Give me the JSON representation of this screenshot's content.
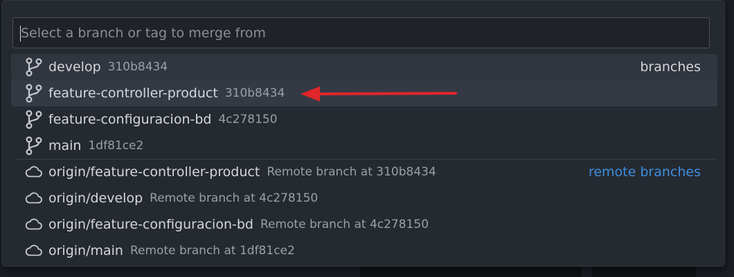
{
  "search": {
    "placeholder": "Select a branch or tag to merge from",
    "value": ""
  },
  "local_branches": {
    "group_label": "branches",
    "items": [
      {
        "name": "develop",
        "detail": "310b8434",
        "icon": "git-branch-icon"
      },
      {
        "name": "feature-controller-product",
        "detail": "310b8434",
        "icon": "git-branch-icon"
      },
      {
        "name": "feature-configuracion-bd",
        "detail": "4c278150",
        "icon": "git-branch-icon"
      },
      {
        "name": "main",
        "detail": "1df81ce2",
        "icon": "git-branch-icon"
      }
    ]
  },
  "remote_branches": {
    "group_label": "remote branches",
    "items": [
      {
        "name": "origin/feature-controller-product",
        "detail": "Remote branch at 310b8434",
        "icon": "cloud-icon"
      },
      {
        "name": "origin/develop",
        "detail": "Remote branch at 4c278150",
        "icon": "cloud-icon"
      },
      {
        "name": "origin/feature-configuracion-bd",
        "detail": "Remote branch at 4c278150",
        "icon": "cloud-icon"
      },
      {
        "name": "origin/main",
        "detail": "Remote branch at 1df81ce2",
        "icon": "cloud-icon"
      }
    ]
  },
  "colors": {
    "annotation_arrow": "#e0262a",
    "remote_group_label": "#3d8ee0"
  }
}
